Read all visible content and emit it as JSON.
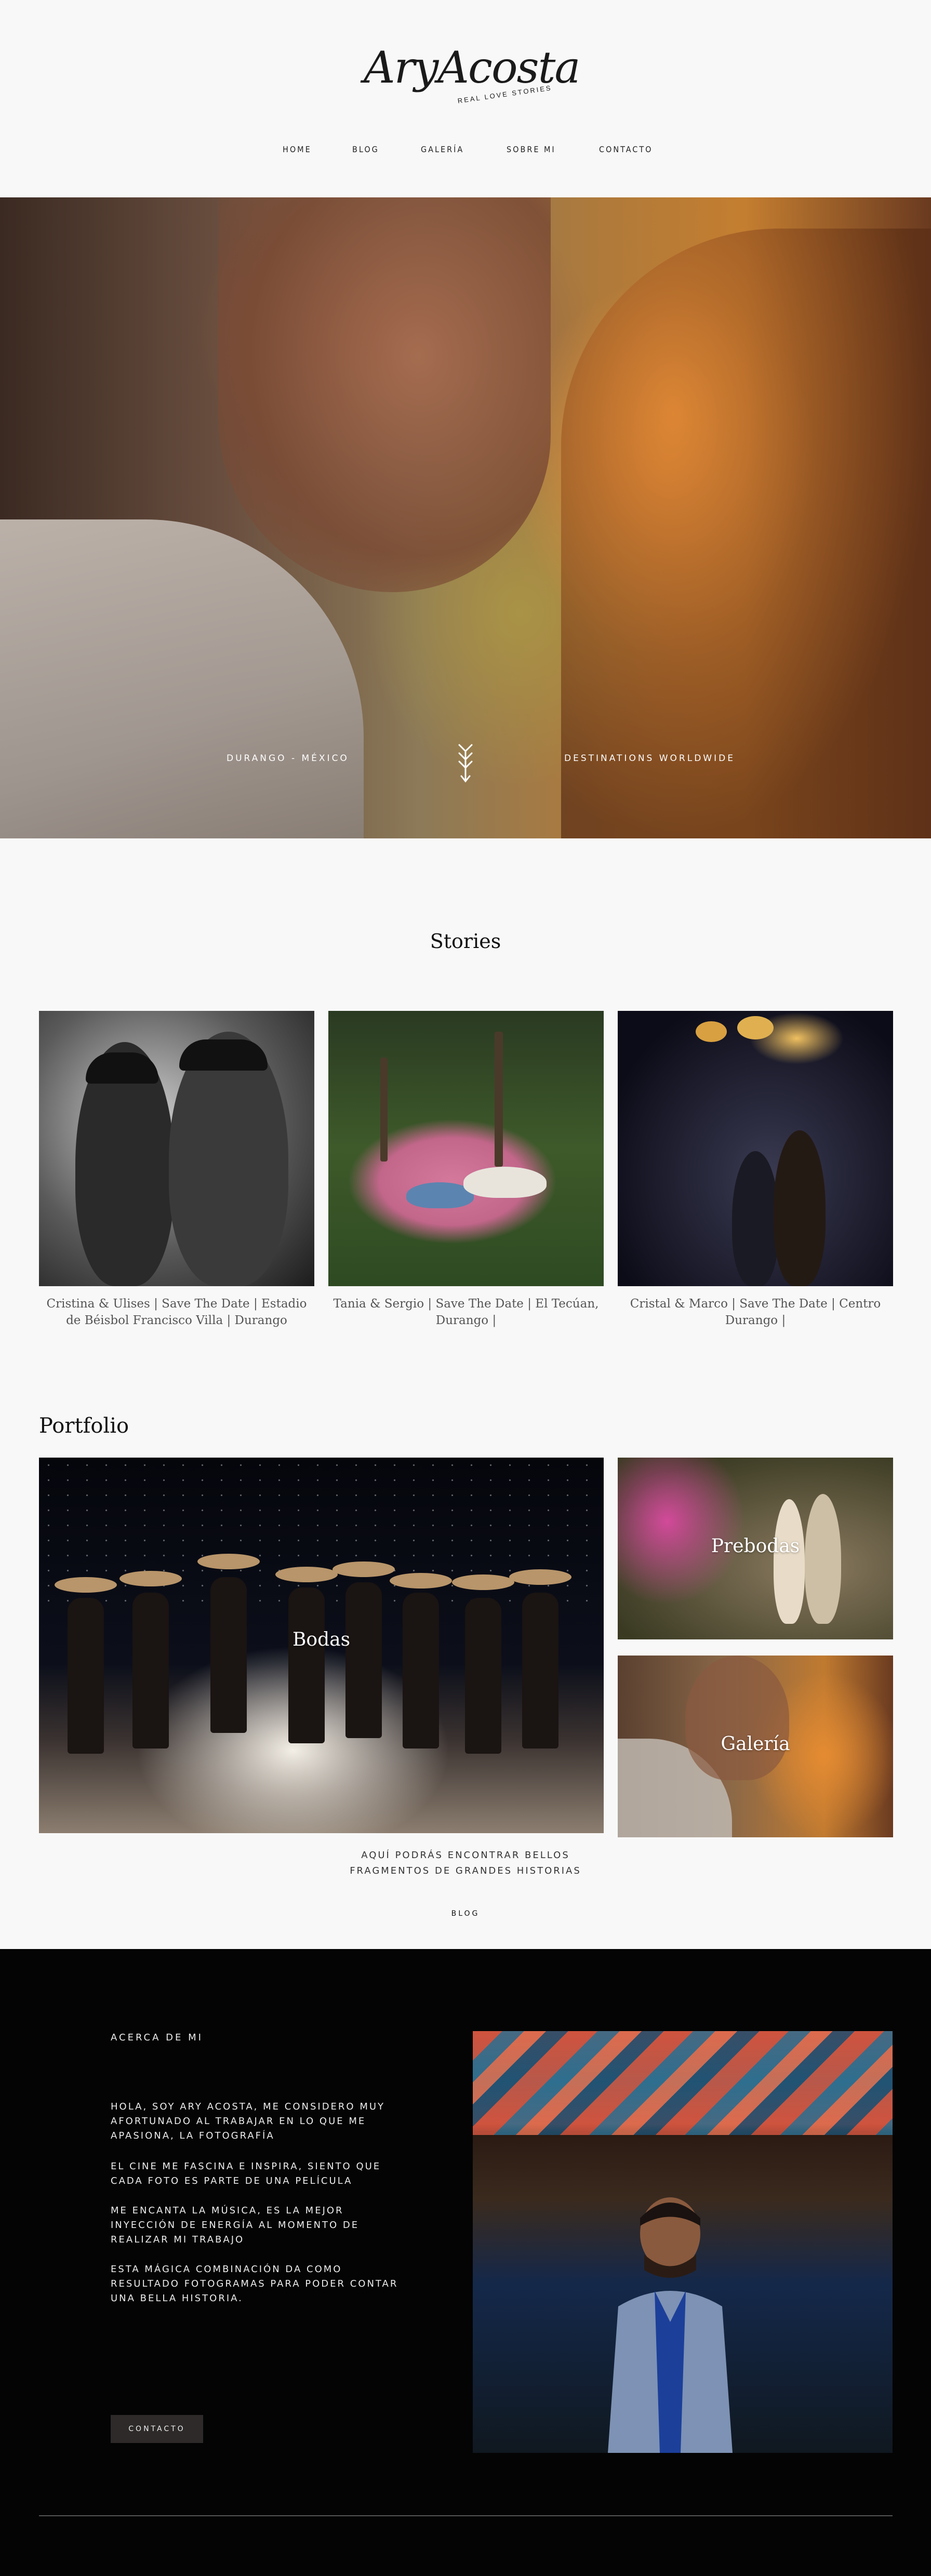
{
  "header": {
    "logo_text": "AryAcosta",
    "logo_tagline": "REAL LOVE STORIES",
    "nav": [
      "HOME",
      "BLOG",
      "GALERÍA",
      "SOBRE MI",
      "CONTACTO"
    ]
  },
  "hero": {
    "caption_left": "DURANGO - MÉXICO",
    "caption_right": "DESTINATIONS WORLDWIDE"
  },
  "stories": {
    "title": "Stories",
    "items": [
      {
        "caption": "Cristina & Ulises | Save The Date | Estadio de Béisbol Francisco Villa | Durango"
      },
      {
        "caption": "Tania & Sergio | Save The Date | El Tecúan, Durango |"
      },
      {
        "caption": "Cristal & Marco | Save The Date | Centro Durango |"
      }
    ]
  },
  "portfolio": {
    "title": "Portfolio",
    "items": [
      {
        "label": "Bodas"
      },
      {
        "label": "Prebodas"
      },
      {
        "label": "Galería"
      }
    ],
    "description_line1": "AQUÍ PODRÁS ENCONTRAR BELLOS",
    "description_line2": "FRAGMENTOS DE GRANDES HISTORIAS",
    "blog_link": "BLOG"
  },
  "about": {
    "title": "ACERCA DE MI",
    "paragraphs": [
      "HOLA, SOY ARY ACOSTA, ME CONSIDERO MUY AFORTUNADO AL TRABAJAR EN LO QUE ME APASIONA, LA FOTOGRAFÍA",
      "EL CINE ME FASCINA E INSPIRA, SIENTO QUE CADA FOTO ES PARTE DE UNA PELÍCULA",
      "ME ENCANTA LA MÚSICA, ES LA MEJOR INYECCIÓN  DE ENERGÍA AL MOMENTO DE REALIZAR MI TRABAJO",
      "ESTA MÁGICA COMBINACIÓN DA COMO RESULTADO FOTOGRAMAS PARA PODER CONTAR UNA BELLA HISTORIA."
    ],
    "button": "CONTACTO"
  }
}
